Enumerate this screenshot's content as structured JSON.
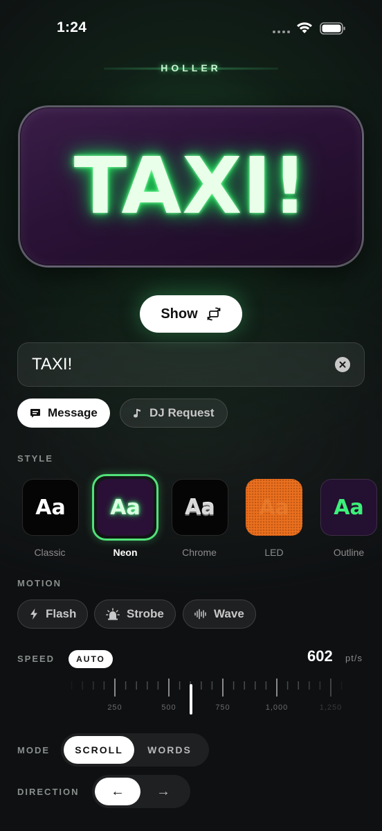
{
  "status": {
    "time": "1:24"
  },
  "app": {
    "brand": "HOLLER"
  },
  "preview": {
    "text": "TAXI!"
  },
  "show_button": {
    "label": "Show"
  },
  "message_input": {
    "value": "TAXI!"
  },
  "type_tabs": [
    {
      "label": "Message",
      "icon": "chat-bubble-icon",
      "active": true
    },
    {
      "label": "DJ Request",
      "icon": "music-note-icon",
      "active": false
    }
  ],
  "style_section": {
    "label": "STYLE",
    "options": [
      {
        "sample": "Aa",
        "label": "Classic"
      },
      {
        "sample": "Aa",
        "label": "Neon",
        "selected": true
      },
      {
        "sample": "Aa",
        "label": "Chrome"
      },
      {
        "sample": "Aa",
        "label": "LED"
      },
      {
        "sample": "Aa",
        "label": "Outline"
      }
    ]
  },
  "motion_section": {
    "label": "MOTION",
    "options": [
      {
        "label": "Flash",
        "icon": "bolt-icon"
      },
      {
        "label": "Strobe",
        "icon": "siren-icon"
      },
      {
        "label": "Wave",
        "icon": "waveform-icon"
      }
    ]
  },
  "speed_section": {
    "label": "SPEED",
    "auto_label": "AUTO",
    "value": "602",
    "unit": "pt/s",
    "scale_labels": [
      "250",
      "500",
      "750",
      "1,000",
      "1,250"
    ]
  },
  "mode_section": {
    "label": "MODE",
    "options": [
      "SCROLL",
      "WORDS"
    ],
    "selected": "SCROLL"
  },
  "direction_section": {
    "label": "DIRECTION",
    "options": [
      "←",
      "→"
    ],
    "selected": "←"
  },
  "colors": {
    "neon_green": "#2eea68",
    "sign_purple": "#2a1236",
    "led_orange": "#e9701f",
    "background": "#0e1012"
  }
}
